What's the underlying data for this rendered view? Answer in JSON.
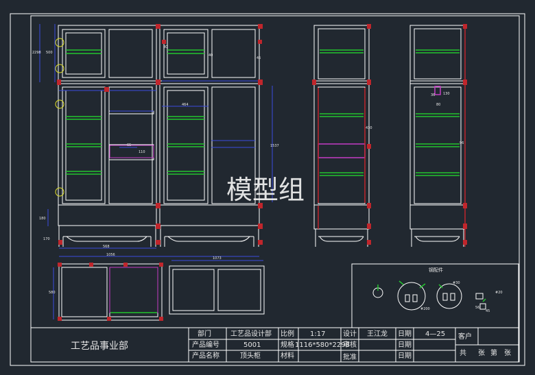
{
  "watermark": "模型组",
  "company": "工艺品事业部",
  "parts_title": "钢配件",
  "title_block": {
    "dept_label": "部门",
    "dept_value": "工艺品设计部",
    "code_label": "产品编号",
    "code_value": "5001",
    "name_label": "产品名称",
    "name_value": "顶头柜",
    "scale_label": "比例",
    "scale_value": "1:17",
    "spec_label": "规格",
    "spec_value": "1116*580*2298",
    "material_label": "材料",
    "design_label": "设计",
    "designer": "王江龙",
    "review_label": "审核",
    "approve_label": "批准",
    "date_label": "日期",
    "date_value": "4—25",
    "client_label": "客户",
    "total_label": "共",
    "sheet_label": "张",
    "page_label": "第",
    "page_unit_label": "张"
  },
  "dimensions": {
    "front_top_overall": "2298",
    "front_top_section": "500",
    "front_upper_gap": "80",
    "front_upper_gap_right": "40",
    "front_upper_gap_far": "45",
    "front_drawer_width": "464",
    "front_drawer_height": "65",
    "front_drawer_depth": "110",
    "front_lower_height": "1537",
    "front_plinth": "180",
    "front_foot": "170",
    "front_half_width": "568",
    "front_total_width": "1056",
    "plan_width": "1073",
    "plan_depth": "580",
    "side_mid": "430",
    "side_right_mid": "96",
    "side_right_a": "36",
    "side_right_b": "130",
    "side_right_c": "80",
    "part_a": "#30",
    "part_b": "#200",
    "part_c": "#20",
    "part_d": "56",
    "part_e": "45"
  }
}
